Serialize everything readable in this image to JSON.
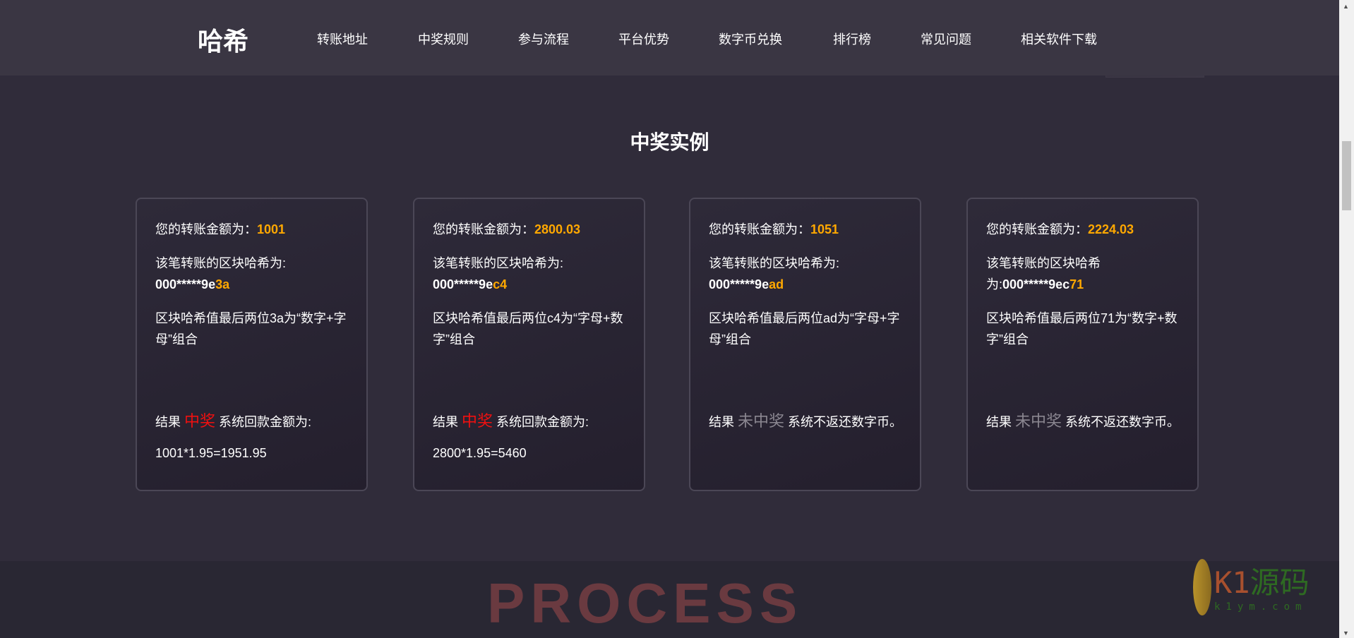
{
  "header": {
    "logo": "哈希",
    "nav": [
      "转账地址",
      "中奖规则",
      "参与流程",
      "平台优势",
      "数字币兑换",
      "排行榜",
      "常见问题",
      "相关软件下载"
    ]
  },
  "section": {
    "title": "中奖实例"
  },
  "cards": [
    {
      "amount_label": "您的转账金额为：",
      "amount": "1001",
      "hash_label": "该笔转账的区块哈希为:",
      "hash_prefix": "000*****9e",
      "hash_suffix": "3a",
      "rule": "区块哈希值最后两位3a为“数字+字母”组合",
      "result_label": "结果",
      "result": "中奖",
      "result_tail": "系统回款金额为:",
      "formula": "1001*1.95=1951.95",
      "won": true
    },
    {
      "amount_label": "您的转账金额为：",
      "amount": "2800.03",
      "hash_label": "该笔转账的区块哈希为:",
      "hash_prefix": "000*****9e",
      "hash_suffix": "c4",
      "rule": "区块哈希值最后两位c4为“字母+数字”组合",
      "result_label": "结果",
      "result": "中奖",
      "result_tail": "系统回款金额为:",
      "formula": "2800*1.95=5460",
      "won": true
    },
    {
      "amount_label": "您的转账金额为：",
      "amount": "1051",
      "hash_label": "该笔转账的区块哈希为:",
      "hash_prefix": "000*****9e",
      "hash_suffix": "ad",
      "rule": "区块哈希值最后两位ad为“字母+字母”组合",
      "result_label": "结果",
      "result": "未中奖",
      "result_tail": "系统不返还数字币。",
      "formula": "",
      "won": false
    },
    {
      "amount_label": "您的转账金额为：",
      "amount": "2224.03",
      "hash_label": "该笔转账的区块哈希为:",
      "hash_prefix": "000*****9ec",
      "hash_suffix": "71",
      "rule": "区块哈希值最后两位71为“数字+数字”组合",
      "result_label": "结果",
      "result": "未中奖",
      "result_tail": "系统不返还数字币。",
      "formula": "",
      "won": false
    }
  ],
  "lower": {
    "heading": "PROCESS"
  },
  "watermark": {
    "brand": "K1",
    "brand_cn": "源码",
    "url": "k1ym.com"
  },
  "colors": {
    "accent": "#ffa800",
    "win": "#f01010",
    "lose": "#8a8690"
  }
}
